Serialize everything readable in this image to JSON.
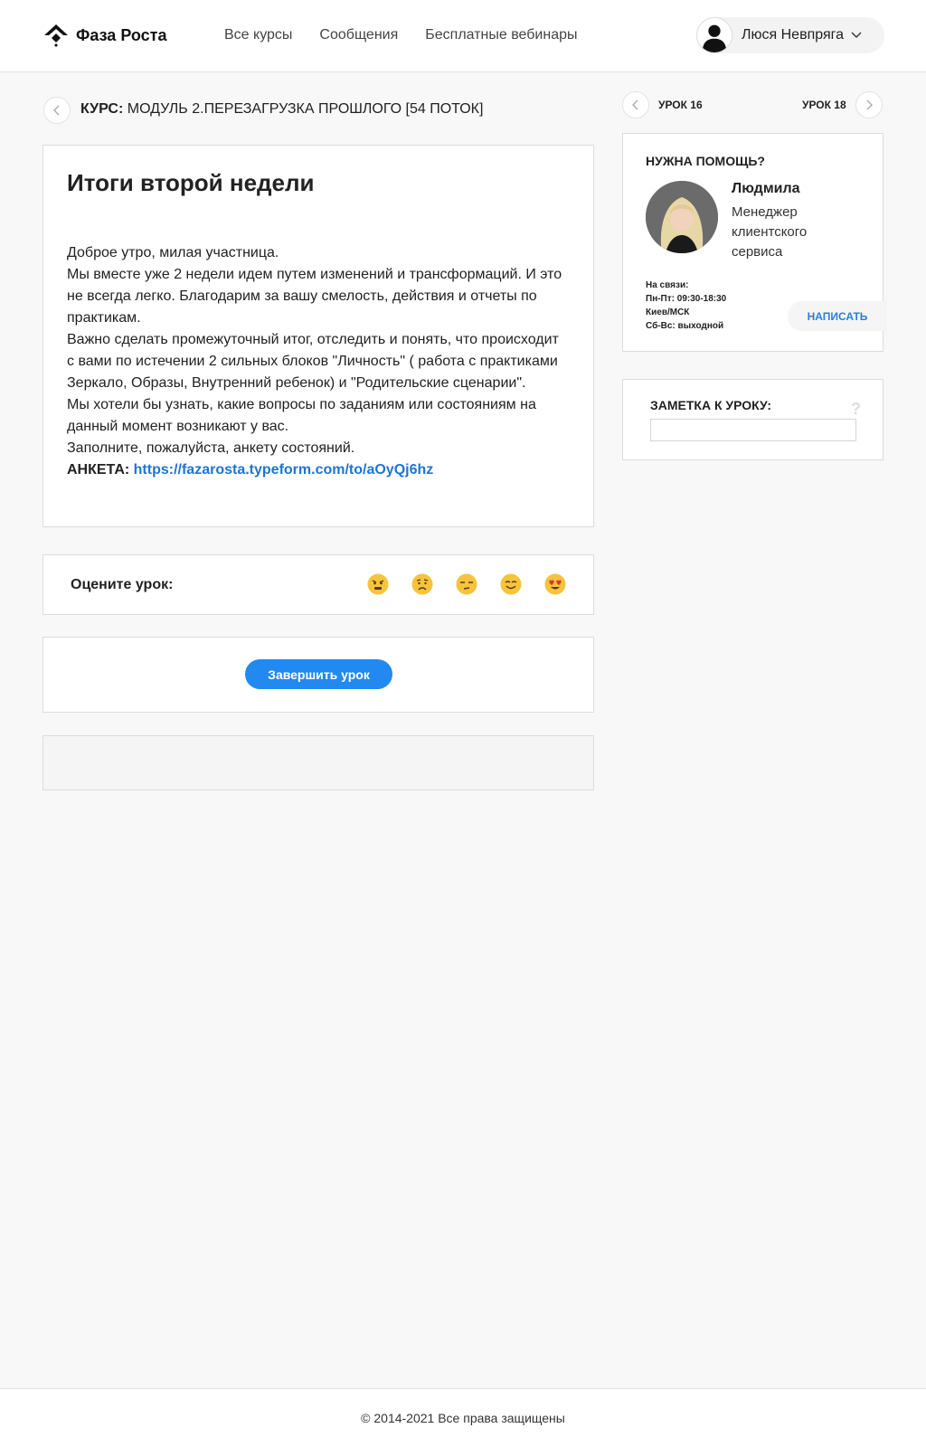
{
  "header": {
    "logo_text": "Фаза Роста",
    "nav": [
      "Все курсы",
      "Сообщения",
      "Бесплатные вебинары"
    ],
    "user_name": "Люся Невпряга"
  },
  "course": {
    "prefix": "КУРС:",
    "name": "МОДУЛЬ 2.ПЕРЕЗАГРУЗКА ПРОШЛОГО [54 ПОТОК]"
  },
  "lesson": {
    "title": "Итоги второй недели",
    "paragraphs": [
      "Доброе утро, милая участница.",
      "Мы вместе уже 2 недели идем путем изменений и трансформаций. И это не всегда легко. Благодарим за вашу смелость, действия и отчеты по практикам.",
      "Важно сделать промежуточный итог, отследить и понять, что происходит с вами по истечении 2 сильных блоков \"Личность\" ( работа с практиками Зеркало, Образы, Внутренний ребенок) и \"Родительские сценарии\".",
      "Мы хотели бы узнать, какие вопросы по заданиям или состояниям на данный момент возникают у вас.",
      "Заполните, пожалуйста, анкету состояний."
    ],
    "anketa_label": "АНКЕТА:",
    "anketa_link": "https://fazarosta.typeform.com/to/aOyQj6hz"
  },
  "rating": {
    "label": "Оцените урок:",
    "emojis": [
      "angry-emoji",
      "sad-emoji",
      "unamused-emoji",
      "smile-emoji",
      "heart-eyes-emoji"
    ]
  },
  "finish": {
    "button": "Завершить урок"
  },
  "lesson_nav": {
    "prev": "УРОК 16",
    "next": "УРОК 18"
  },
  "help": {
    "title": "НУЖНА ПОМОЩЬ?",
    "manager_name": "Людмила",
    "manager_role": "Менеджер клиентского сервиса",
    "contact": [
      "На связи:",
      "Пн-Пт: 09:30-18:30",
      "Киев/МСК",
      "Сб-Вс: выходной"
    ],
    "write_button": "НАПИСАТЬ"
  },
  "note": {
    "title": "ЗАМЕТКА К УРОКУ:",
    "help_mark": "?",
    "value": ""
  },
  "footer": {
    "copyright": "© 2014-2021 Все права защищены"
  },
  "colors": {
    "accent": "#2289f1",
    "link": "#1e74d6",
    "background": "#f8f8f8"
  }
}
